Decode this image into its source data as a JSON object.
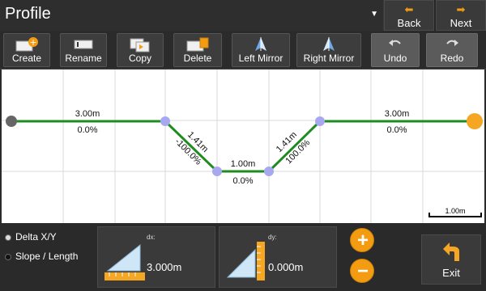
{
  "header": {
    "title": "Profile",
    "back_label": "Back",
    "next_label": "Next"
  },
  "toolbar": {
    "create": "Create",
    "rename": "Rename",
    "copy": "Copy",
    "delete": "Delete",
    "left_mirror": "Left Mirror",
    "right_mirror": "Right Mirror",
    "undo": "Undo",
    "redo": "Redo"
  },
  "profile": {
    "segments": [
      {
        "length": "3.00m",
        "slope": "0.0%"
      },
      {
        "length": "1.41m",
        "slope": "-100.0%"
      },
      {
        "length": "1.00m",
        "slope": "0.0%"
      },
      {
        "length": "1.41m",
        "slope": "100.0%"
      },
      {
        "length": "3.00m",
        "slope": "0.0%"
      }
    ],
    "scale_label": "1.00m",
    "colors": {
      "line": "#1f8c1f",
      "start_point": "#666666",
      "mid_point": "#a8a8f0",
      "end_point": "#f5a623"
    }
  },
  "bottom": {
    "mode_options": [
      "Delta X/Y",
      "Slope / Length"
    ],
    "selected_mode": "Delta X/Y",
    "dx_caption": "dx:",
    "dx_value": "3.000m",
    "dy_caption": "dy:",
    "dy_value": "0.000m",
    "plus_label": "+",
    "minus_label": "−",
    "exit_label": "Exit"
  }
}
